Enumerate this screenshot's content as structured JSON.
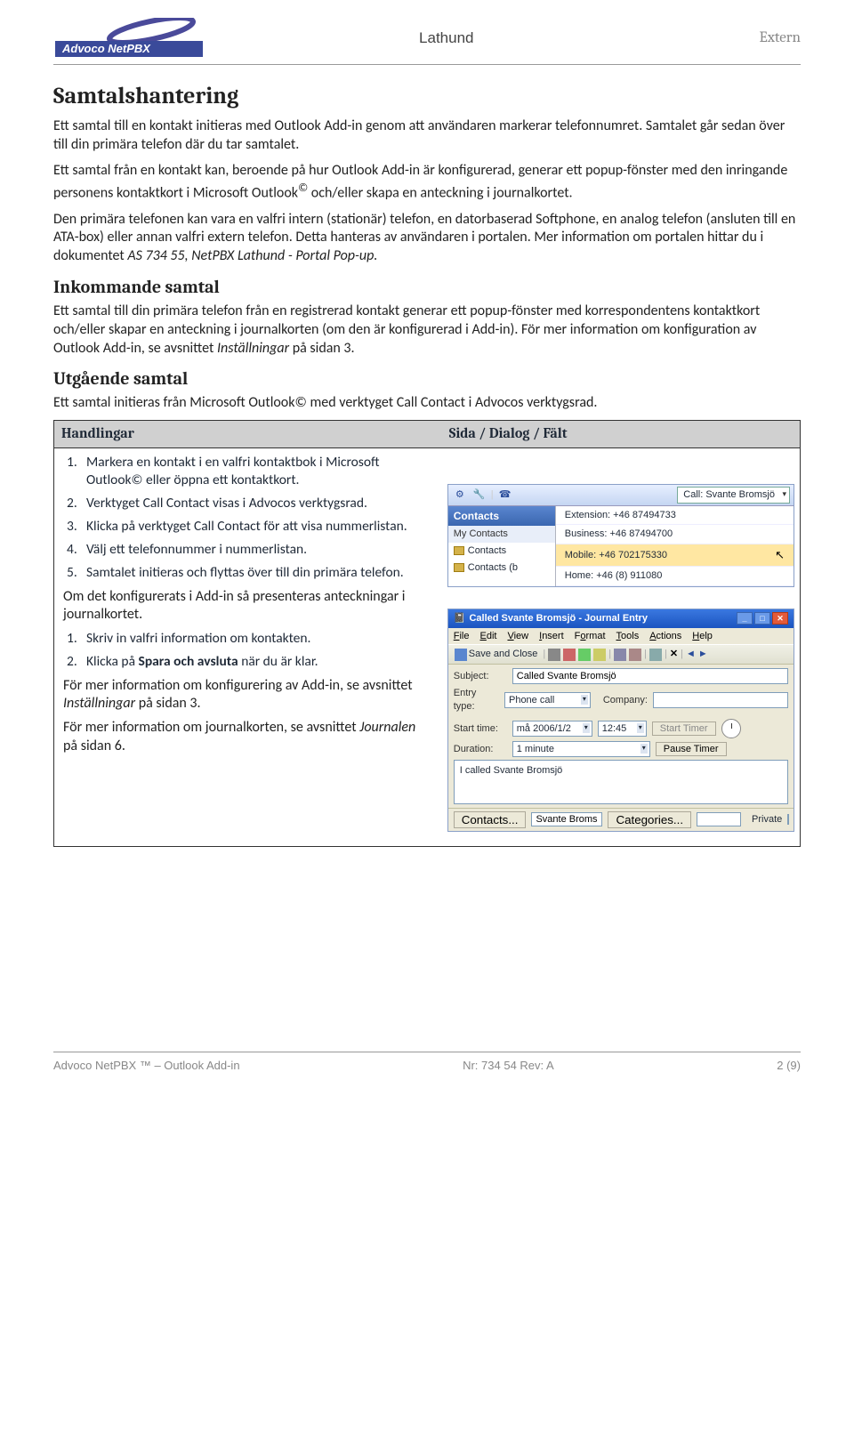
{
  "header": {
    "brand_upper": "Advoco NetPBX",
    "title": "Lathund",
    "right": "Extern"
  },
  "h1": "Samtalshantering",
  "p1": "Ett samtal till en kontakt initieras med Outlook Add-in genom att användaren markerar telefonnumret. Samtalet går sedan över till din primära telefon där du tar samtalet.",
  "p2a": "Ett samtal från en kontakt kan, beroende på hur Outlook Add-in är konfigurerad, generar ett popup-fönster med den inringande personens kontaktkort i Microsoft Outlook",
  "p2b": " och/eller skapa en anteckning i journalkortet.",
  "p3a": "Den primära telefonen kan vara en valfri intern (stationär) telefon, en datorbaserad Softphone, en analog telefon (ansluten till en ATA-box) eller annan valfri extern telefon. Detta hanteras av användaren i portalen. Mer information om portalen hittar du i dokumentet ",
  "p3b": "AS 734 55, NetPBX Lathund - Portal Pop-up.",
  "h2a": "Inkommande samtal",
  "p4a": "Ett samtal till din primära telefon från en registrerad kontakt generar ett popup-fönster med korrespondentens kontaktkort och/eller skapar en anteckning i journalkorten (om den är konfigurerad i Add-in). För mer information om konfiguration av Outlook Add-in, se avsnittet ",
  "p4b": "Inställningar",
  "p4c": " på sidan 3.",
  "h2b": "Utgående samtal",
  "p5": "Ett samtal initieras från Microsoft Outlook© med verktyget Call Contact i Advocos verktygsrad.",
  "table": {
    "head_left": "Handlingar",
    "head_right": "Sida / Dialog / Fält",
    "steps": [
      {
        "n": "1.",
        "t": "Markera en kontakt i en valfri kontaktbok i Microsoft Outlook© eller öppna ett kontaktkort."
      },
      {
        "n": "2.",
        "t": "Verktyget Call Contact visas i Advocos verktygsrad."
      },
      {
        "n": "3.",
        "t": "Klicka på verktyget Call Contact för att visa nummerlistan."
      },
      {
        "n": "4.",
        "t": "Välj ett telefonnummer i nummerlistan."
      },
      {
        "n": "5.",
        "t": "Samtalet initieras och flyttas över till din primära telefon."
      }
    ],
    "mid_para": "Om det konfigurerats i Add-in så presenteras anteckningar i journalkortet.",
    "steps2": [
      {
        "n": "1.",
        "t": "Skriv in valfri information om kontakten."
      },
      {
        "n": "2.",
        "t": "Klicka på Spara och avsluta när du är klar."
      }
    ],
    "tail1a": "För mer information om konfigurering av Add-in, se avsnittet ",
    "tail1b": "Inställningar",
    "tail1c": " på sidan 3.",
    "tail2a": "För mer information om journalkorten, se avsnittet ",
    "tail2b": "Journalen",
    "tail2c": " på sidan 6."
  },
  "shot1": {
    "dropdown": "Call: Svante Bromsjö",
    "contacts_header": "Contacts",
    "my_contacts": "My Contacts",
    "item1": "Contacts",
    "item2": "Contacts (b",
    "num1": "Extension: +46 87494733",
    "num2": "Business: +46 87494700",
    "num3": "Mobile: +46 702175330",
    "num4": "Home: +46 (8) 911080"
  },
  "shot2": {
    "title": "Called Svante Bromsjö - Journal Entry",
    "menu": [
      "File",
      "Edit",
      "View",
      "Insert",
      "Format",
      "Tools",
      "Actions",
      "Help"
    ],
    "save_close": "Save and Close",
    "subject_label": "Subject:",
    "subject_val": "Called Svante Bromsjö",
    "entry_label": "Entry type:",
    "entry_val": "Phone call",
    "company_label": "Company:",
    "company_val": "",
    "start_label": "Start time:",
    "start_date": "må 2006/1/2",
    "start_time": "12:45",
    "start_timer": "Start Timer",
    "duration_label": "Duration:",
    "duration_val": "1 minute",
    "pause_timer": "Pause Timer",
    "memo": "I called Svante Bromsjö",
    "btn_contacts": "Contacts...",
    "btn_svante": "Svante Broms",
    "btn_categories": "Categories...",
    "private": "Private"
  },
  "footer": {
    "left": "Advoco NetPBX ™ – Outlook Add-in",
    "center": "Nr: 734 54 Rev: A",
    "right": "2 (9)"
  }
}
